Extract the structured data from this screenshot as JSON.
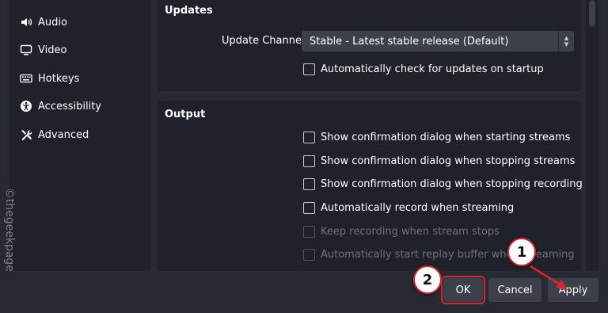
{
  "sidebar": {
    "items": [
      {
        "label": "Audio",
        "icon": "speaker-icon"
      },
      {
        "label": "Video",
        "icon": "monitor-icon"
      },
      {
        "label": "Hotkeys",
        "icon": "keyboard-icon"
      },
      {
        "label": "Accessibility",
        "icon": "accessibility-icon"
      },
      {
        "label": "Advanced",
        "icon": "tools-icon"
      }
    ]
  },
  "updates": {
    "title": "Updates",
    "channel_label": "Update Channel",
    "channel_value": "Stable - Latest stable release (Default)",
    "auto_check_label": "Automatically check for updates on startup"
  },
  "output": {
    "title": "Output",
    "options": [
      {
        "label": "Show confirmation dialog when starting streams",
        "checked": false,
        "enabled": true
      },
      {
        "label": "Show confirmation dialog when stopping streams",
        "checked": false,
        "enabled": true
      },
      {
        "label": "Show confirmation dialog when stopping recording",
        "checked": false,
        "enabled": true
      },
      {
        "label": "Automatically record when streaming",
        "checked": false,
        "enabled": true
      },
      {
        "label": "Keep recording when stream stops",
        "checked": false,
        "enabled": false
      },
      {
        "label": "Automatically start replay buffer when streaming",
        "checked": false,
        "enabled": false
      }
    ]
  },
  "buttons": {
    "ok": "OK",
    "cancel": "Cancel",
    "apply": "Apply"
  },
  "annotations": {
    "marker_1": "1",
    "marker_2": "2",
    "highlight_color": "#d8262a"
  },
  "watermark": "©thegeekpage.com"
}
